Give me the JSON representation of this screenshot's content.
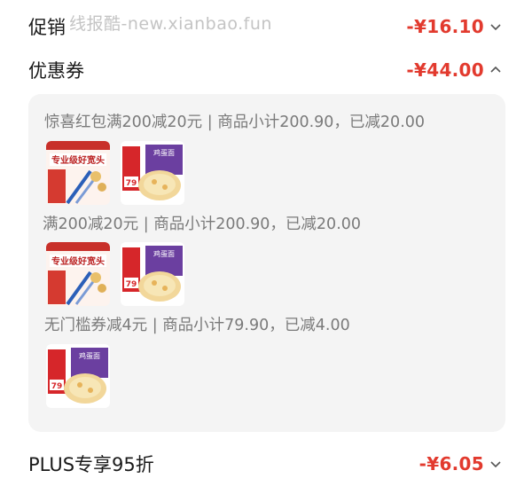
{
  "watermark": "线报酷-new.xianbao.fun",
  "promo": {
    "label": "促销",
    "amount": "-¥16.10"
  },
  "coupon": {
    "label": "优惠券",
    "amount": "-¥44.00"
  },
  "coupon_details": [
    {
      "title": "惊喜红包满200减20元 | 商品小计200.90，已减20.00",
      "products": [
        "专业级好宽头",
        "鸡蛋面"
      ]
    },
    {
      "title": "满200减20元 | 商品小计200.90，已减20.00",
      "products": [
        "专业级好宽头",
        "鸡蛋面"
      ]
    },
    {
      "title": "无门槛券减4元 | 商品小计79.90，已减4.00",
      "products": [
        "鸡蛋面"
      ]
    }
  ],
  "product_texts": {
    "brush_headline": "专业级好宽头",
    "noodle_price": "79",
    "noodle_badge": "鸡蛋面"
  },
  "plus": {
    "label": "PLUS专享95折",
    "amount": "-¥6.05"
  },
  "colors": {
    "accent": "#e23a2e",
    "panel": "#f4f4f4"
  }
}
